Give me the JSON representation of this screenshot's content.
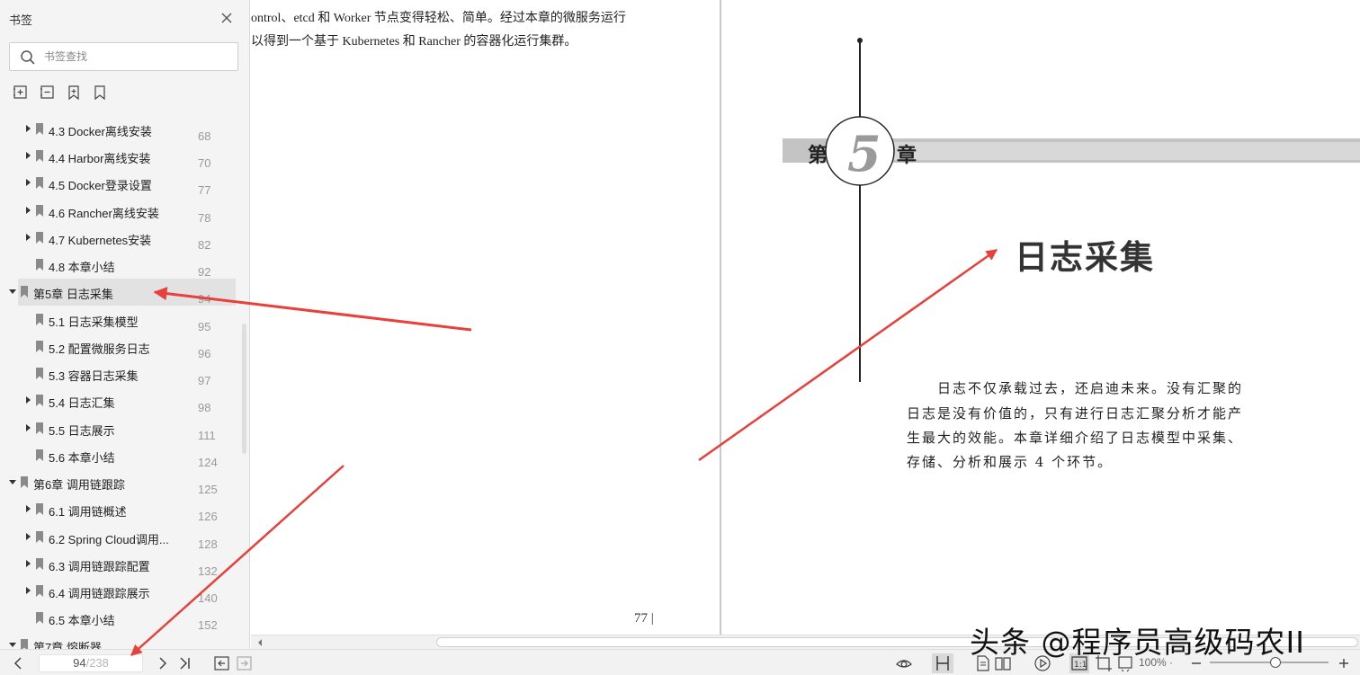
{
  "sidebar": {
    "title": "书签",
    "search_placeholder": "书签查找",
    "bookmarks": [
      {
        "label": "4.3 Docker离线安装",
        "page": "68"
      },
      {
        "label": "4.4 Harbor离线安装",
        "page": "70"
      },
      {
        "label": "4.5 Docker登录设置",
        "page": "77"
      },
      {
        "label": "4.6 Rancher离线安装",
        "page": "78"
      },
      {
        "label": "4.7 Kubernetes安装",
        "page": "82"
      },
      {
        "label": "4.8 本章小结",
        "page": "92"
      },
      {
        "label": "第5章 日志采集",
        "page": "94"
      },
      {
        "label": "5.1 日志采集模型",
        "page": "95"
      },
      {
        "label": "5.2 配置微服务日志",
        "page": "96"
      },
      {
        "label": "5.3 容器日志采集",
        "page": "97"
      },
      {
        "label": "5.4 日志汇集",
        "page": "98"
      },
      {
        "label": "5.5 日志展示",
        "page": "111"
      },
      {
        "label": "5.6 本章小结",
        "page": "124"
      },
      {
        "label": "第6章 调用链跟踪",
        "page": "125"
      },
      {
        "label": "6.1 调用链概述",
        "page": "126"
      },
      {
        "label": "6.2 Spring Cloud调用...",
        "page": "128"
      },
      {
        "label": "6.3 调用链跟踪配置",
        "page": "132"
      },
      {
        "label": "6.4 调用链跟踪展示",
        "page": "140"
      },
      {
        "label": "6.5 本章小结",
        "page": "152"
      },
      {
        "label": "第7章 熔断器",
        "page": ""
      }
    ]
  },
  "document": {
    "left_page": {
      "line1": "ontrol、etcd 和 Worker 节点变得轻松、简单。经过本章的微服务运行",
      "line2": "以得到一个基于 Kubernetes 和 Rancher 的容器化运行集群。",
      "page_number": "77 |"
    },
    "right_page": {
      "chapter_prefix": "第",
      "chapter_number": "5",
      "chapter_suffix": "章",
      "chapter_title": "日志采集",
      "intro_lines": [
        "日志不仅承载过去，还启迪未来。没有汇聚的",
        "日志是没有价值的，只有进行日志汇聚分析才能产",
        "生最大的效能。本章详细介绍了日志模型中采集、",
        "存储、分析和展示 4 个环节。"
      ]
    }
  },
  "statusbar": {
    "current_page": "94",
    "total_pages": "/238",
    "zoom": "100% ·",
    "watermark": "头条 @程序员高级码农II"
  },
  "colors": {
    "arrow": "#e8403a",
    "sidebar_bg": "#f4f4f4",
    "selected_row": "#e2e2e2"
  }
}
